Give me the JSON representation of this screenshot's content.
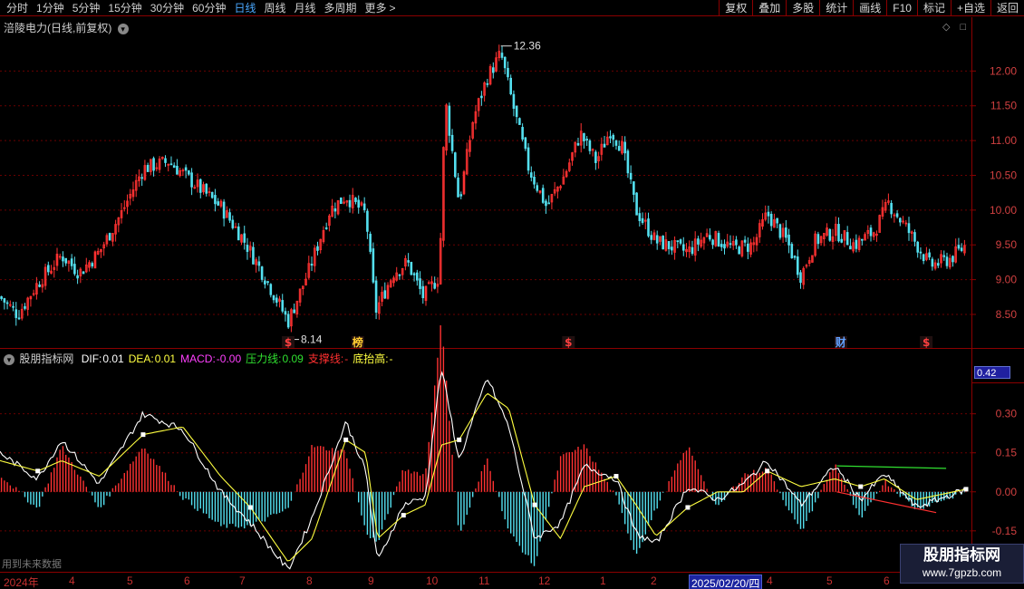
{
  "toolbar": {
    "periods": [
      "分时",
      "1分钟",
      "5分钟",
      "15分钟",
      "30分钟",
      "60分钟",
      "日线",
      "周线",
      "月线",
      "多周期",
      "更多"
    ],
    "active_period": "日线",
    "more_arrow": ">",
    "tools": [
      "复权",
      "叠加",
      "多股",
      "统计",
      "画线",
      "F10",
      "标记",
      "+自选",
      "返回"
    ]
  },
  "stock": {
    "title": "涪陵电力(日线,前复权)",
    "expand_icon": "chevron-down-circle-icon",
    "corner_icons": [
      "diamond-icon",
      "square-icon"
    ]
  },
  "indicator": {
    "name": "股朋指标网",
    "items": [
      {
        "label": "DIF:",
        "value": "0.01",
        "color": "#ffffff"
      },
      {
        "label": "DEA:",
        "value": "0.01",
        "color": "#ffff40"
      },
      {
        "label": "MACD:",
        "value": "-0.00",
        "color": "#ff40ff"
      },
      {
        "label": "压力线:",
        "value": "0.09",
        "color": "#30e030"
      },
      {
        "label": "支撑线:",
        "value": "-",
        "color": "#ff3030"
      },
      {
        "label": "底抬高:",
        "value": "-",
        "color": "#ffff40"
      }
    ],
    "current_value": "0.42",
    "future_note": "用到未来数据"
  },
  "markers": [
    {
      "text": "$",
      "color": "#ff4040",
      "date": "2024-07-24"
    },
    {
      "text": "榜",
      "color": "#ffcc30",
      "date": "2024-08-28"
    },
    {
      "text": "$",
      "color": "#ff4040",
      "date": "2024-12-12"
    },
    {
      "text": "财",
      "color": "#60a0ff",
      "date": "2025-04-28"
    },
    {
      "text": "$",
      "color": "#ff4040",
      "date": "2025-06-10"
    }
  ],
  "annotations": {
    "high_label": "12.36",
    "low_label": "8.14"
  },
  "time_axis": {
    "labels": [
      "2024年",
      "4",
      "5",
      "6",
      "7",
      "8",
      "9",
      "10",
      "11",
      "12",
      "1",
      "2",
      "2025/02/20/四",
      "4",
      "5",
      "6"
    ],
    "highlighted": "2025/02/20/四"
  },
  "watermark": {
    "name": "股朋指标网",
    "url": "www.7gpzb.com"
  },
  "colors": {
    "up": "#ff3232",
    "down": "#54e0f0",
    "frame": "#8b0000",
    "dif": "#ffffff",
    "dea": "#ffff40",
    "pressure": "#30e030",
    "support": "#ff3030",
    "active": "#4aa8ff"
  },
  "chart_data": [
    {
      "type": "candlestick",
      "title": "涪陵电力(日线,前复权)",
      "ylim": [
        8.2,
        12.5
      ],
      "yticks": [
        8.5,
        9.0,
        9.5,
        10.0,
        10.5,
        11.0,
        11.5,
        12.0
      ],
      "ytick_labels": [
        "8.50",
        "9.00",
        "9.50",
        "10.00",
        "10.50",
        "11.00",
        "11.50",
        "12.00"
      ],
      "high": 12.36,
      "low": 8.14,
      "close_path": [
        {
          "d": "2024-03-01",
          "c": 8.75
        },
        {
          "d": "2024-03-10",
          "c": 8.5
        },
        {
          "d": "2024-03-20",
          "c": 8.95
        },
        {
          "d": "2024-04-01",
          "c": 9.35
        },
        {
          "d": "2024-04-10",
          "c": 9.1
        },
        {
          "d": "2024-04-20",
          "c": 9.4
        },
        {
          "d": "2024-05-01",
          "c": 9.95
        },
        {
          "d": "2024-05-12",
          "c": 10.6
        },
        {
          "d": "2024-05-25",
          "c": 10.7
        },
        {
          "d": "2024-06-08",
          "c": 10.35
        },
        {
          "d": "2024-06-20",
          "c": 10.05
        },
        {
          "d": "2024-07-01",
          "c": 9.6
        },
        {
          "d": "2024-07-12",
          "c": 9.05
        },
        {
          "d": "2024-07-24",
          "c": 8.4
        },
        {
          "d": "2024-08-03",
          "c": 9.1
        },
        {
          "d": "2024-08-14",
          "c": 10.0
        },
        {
          "d": "2024-08-22",
          "c": 10.2
        },
        {
          "d": "2024-09-01",
          "c": 9.95
        },
        {
          "d": "2024-09-06",
          "c": 8.55
        },
        {
          "d": "2024-09-15",
          "c": 9.1
        },
        {
          "d": "2024-09-22",
          "c": 9.25
        },
        {
          "d": "2024-09-30",
          "c": 8.75
        },
        {
          "d": "2024-10-08",
          "c": 9.05
        },
        {
          "d": "2024-10-11",
          "c": 11.6
        },
        {
          "d": "2024-10-18",
          "c": 10.1
        },
        {
          "d": "2024-10-25",
          "c": 11.3
        },
        {
          "d": "2024-11-01",
          "c": 11.9
        },
        {
          "d": "2024-11-08",
          "c": 12.25
        },
        {
          "d": "2024-11-15",
          "c": 11.4
        },
        {
          "d": "2024-11-22",
          "c": 10.6
        },
        {
          "d": "2024-12-01",
          "c": 10.05
        },
        {
          "d": "2024-12-10",
          "c": 10.5
        },
        {
          "d": "2024-12-18",
          "c": 11.1
        },
        {
          "d": "2024-12-26",
          "c": 10.7
        },
        {
          "d": "2025-01-02",
          "c": 11.15
        },
        {
          "d": "2025-01-08",
          "c": 10.9
        },
        {
          "d": "2025-01-15",
          "c": 10.0
        },
        {
          "d": "2025-01-25",
          "c": 9.55
        },
        {
          "d": "2025-02-10",
          "c": 9.4
        },
        {
          "d": "2025-02-20",
          "c": 9.65
        },
        {
          "d": "2025-03-05",
          "c": 9.45
        },
        {
          "d": "2025-03-15",
          "c": 9.5
        },
        {
          "d": "2025-03-22",
          "c": 9.95
        },
        {
          "d": "2025-04-01",
          "c": 9.55
        },
        {
          "d": "2025-04-08",
          "c": 9.05
        },
        {
          "d": "2025-04-15",
          "c": 9.55
        },
        {
          "d": "2025-04-25",
          "c": 9.7
        },
        {
          "d": "2025-05-05",
          "c": 9.5
        },
        {
          "d": "2025-05-15",
          "c": 9.7
        },
        {
          "d": "2025-05-22",
          "c": 10.1
        },
        {
          "d": "2025-06-01",
          "c": 9.7
        },
        {
          "d": "2025-06-12",
          "c": 9.2
        },
        {
          "d": "2025-06-22",
          "c": 9.3
        },
        {
          "d": "2025-06-30",
          "c": 9.5
        }
      ]
    },
    {
      "type": "line",
      "title": "股朋指标网",
      "ylim": [
        -0.29,
        0.48
      ],
      "yticks": [
        -0.15,
        0.0,
        0.15,
        0.3
      ],
      "ytick_labels": [
        "-0.15",
        "0.00",
        "0.15",
        "0.30"
      ],
      "series": [
        {
          "name": "DIF",
          "color": "#ffffff",
          "points": [
            {
              "d": "2024-03-01",
              "v": 0.15
            },
            {
              "d": "2024-03-20",
              "v": 0.05
            },
            {
              "d": "2024-04-01",
              "v": 0.2
            },
            {
              "d": "2024-04-20",
              "v": 0.03
            },
            {
              "d": "2024-05-12",
              "v": 0.3
            },
            {
              "d": "2024-06-01",
              "v": 0.24
            },
            {
              "d": "2024-06-20",
              "v": 0.0
            },
            {
              "d": "2024-07-05",
              "v": -0.12
            },
            {
              "d": "2024-07-24",
              "v": -0.3
            },
            {
              "d": "2024-08-05",
              "v": -0.1
            },
            {
              "d": "2024-08-22",
              "v": 0.27
            },
            {
              "d": "2024-09-01",
              "v": 0.08
            },
            {
              "d": "2024-09-07",
              "v": -0.27
            },
            {
              "d": "2024-09-20",
              "v": -0.05
            },
            {
              "d": "2024-10-01",
              "v": -0.02
            },
            {
              "d": "2024-10-09",
              "v": 0.48
            },
            {
              "d": "2024-10-18",
              "v": 0.12
            },
            {
              "d": "2024-11-01",
              "v": 0.44
            },
            {
              "d": "2024-11-12",
              "v": 0.25
            },
            {
              "d": "2024-11-25",
              "v": -0.18
            },
            {
              "d": "2024-12-08",
              "v": -0.12
            },
            {
              "d": "2024-12-20",
              "v": 0.1
            },
            {
              "d": "2025-01-05",
              "v": 0.05
            },
            {
              "d": "2025-01-15",
              "v": -0.16
            },
            {
              "d": "2025-01-25",
              "v": -0.2
            },
            {
              "d": "2025-02-10",
              "v": 0.02
            },
            {
              "d": "2025-02-25",
              "v": -0.03
            },
            {
              "d": "2025-03-10",
              "v": 0.03
            },
            {
              "d": "2025-03-22",
              "v": 0.12
            },
            {
              "d": "2025-04-08",
              "v": -0.05
            },
            {
              "d": "2025-04-25",
              "v": 0.1
            },
            {
              "d": "2025-05-08",
              "v": -0.03
            },
            {
              "d": "2025-05-20",
              "v": 0.07
            },
            {
              "d": "2025-06-05",
              "v": -0.06
            },
            {
              "d": "2025-06-30",
              "v": 0.01
            }
          ]
        },
        {
          "name": "DEA",
          "color": "#ffff40",
          "points": [
            {
              "d": "2024-03-01",
              "v": 0.12
            },
            {
              "d": "2024-03-20",
              "v": 0.08
            },
            {
              "d": "2024-04-01",
              "v": 0.12
            },
            {
              "d": "2024-04-20",
              "v": 0.06
            },
            {
              "d": "2024-05-12",
              "v": 0.22
            },
            {
              "d": "2024-06-01",
              "v": 0.25
            },
            {
              "d": "2024-06-20",
              "v": 0.06
            },
            {
              "d": "2024-07-05",
              "v": -0.06
            },
            {
              "d": "2024-07-24",
              "v": -0.27
            },
            {
              "d": "2024-08-05",
              "v": -0.18
            },
            {
              "d": "2024-08-22",
              "v": 0.2
            },
            {
              "d": "2024-09-01",
              "v": 0.15
            },
            {
              "d": "2024-09-07",
              "v": -0.18
            },
            {
              "d": "2024-09-20",
              "v": -0.09
            },
            {
              "d": "2024-10-01",
              "v": -0.05
            },
            {
              "d": "2024-10-09",
              "v": 0.18
            },
            {
              "d": "2024-10-18",
              "v": 0.2
            },
            {
              "d": "2024-11-01",
              "v": 0.38
            },
            {
              "d": "2024-11-12",
              "v": 0.32
            },
            {
              "d": "2024-11-25",
              "v": -0.05
            },
            {
              "d": "2024-12-08",
              "v": -0.18
            },
            {
              "d": "2024-12-20",
              "v": 0.02
            },
            {
              "d": "2025-01-05",
              "v": 0.06
            },
            {
              "d": "2025-01-15",
              "v": -0.05
            },
            {
              "d": "2025-01-25",
              "v": -0.17
            },
            {
              "d": "2025-02-10",
              "v": -0.06
            },
            {
              "d": "2025-02-25",
              "v": 0.0
            },
            {
              "d": "2025-03-10",
              "v": 0.0
            },
            {
              "d": "2025-03-22",
              "v": 0.08
            },
            {
              "d": "2025-04-08",
              "v": 0.02
            },
            {
              "d": "2025-04-25",
              "v": 0.05
            },
            {
              "d": "2025-05-08",
              "v": 0.02
            },
            {
              "d": "2025-05-20",
              "v": 0.05
            },
            {
              "d": "2025-06-05",
              "v": -0.03
            },
            {
              "d": "2025-06-30",
              "v": 0.01
            }
          ]
        },
        {
          "name": "压力线",
          "color": "#30e030",
          "points": [
            {
              "d": "2025-04-26",
              "v": 0.1
            },
            {
              "d": "2025-06-20",
              "v": 0.09
            }
          ]
        },
        {
          "name": "支撑线",
          "color": "#ff3030",
          "points": [
            {
              "d": "2025-04-26",
              "v": 0.0
            },
            {
              "d": "2025-06-15",
              "v": -0.08
            }
          ]
        }
      ]
    }
  ]
}
